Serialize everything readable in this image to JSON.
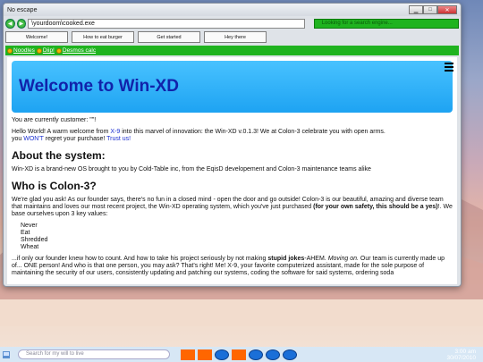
{
  "window": {
    "title": "No escape",
    "address": "\\yourdoom\\cooked.exe",
    "search_placeholder": "Looking for a search engine..."
  },
  "tabs": [
    "Welcome!",
    "How to eat burger",
    "Get started",
    "Hey there"
  ],
  "bookmarks": [
    "Noodles",
    "Diip!",
    "Desmos calc"
  ],
  "page": {
    "banner_title": "Welcome to Win-XD",
    "customer_line": "You are currently customer: \"\"!",
    "intro_a": "Hello World! A warm welcome from ",
    "intro_link": "X-9",
    "intro_b": " into this marvel of innovation: the Win-XD v.0.1.3! We at Colon-3 celebrate you with open arms.",
    "intro_c_pre": "you ",
    "intro_c_wont": "WON'T",
    "intro_c_mid": " regret your purchase! ",
    "intro_c_trust": "Trust us!",
    "h_system": "About the system:",
    "system_text": "Win-XD is a brand-new OS brought to you by Cold-Table inc, from the EqisD developement and Colon-3 maintenance teams alike",
    "h_colon": "Who is Colon-3?",
    "colon_text": "We're glad you ask! As our founder says, there's no fun in a closed mind - open the door and go outside! Colon-3 is our beautiful, amazing and diverse team that maintains and loves our most recent project, the Win-XD operating system, which you've just purchased ",
    "colon_bold": "(for your own safety, this should be a yes)",
    "colon_tail": "!. We base ourselves upon 3 key values:",
    "values": [
      "Never",
      "Eat",
      "Shredded",
      "Wheat"
    ],
    "closing_a": "...if only our founder knew how to count. And how to take his project seriously by not making ",
    "closing_bold": "stupid jokes",
    "closing_b": "-AHEM. ",
    "closing_italic": "Moving on.",
    "closing_c": " Our team is currently made up of... ONE person! And who is that one person, you may ask? That's right! Me! X-9, your favorite computerized assistant, made for the sole purpose of maintaining the security of our users, consistently updating and patching our systems, coding the software for said systems, ordering soda"
  },
  "taskbar": {
    "search_placeholder": "Search for my will to live",
    "time": "3:00 am",
    "date": "30/07/2010"
  },
  "colors": {
    "accent_green": "#1fb31f",
    "banner_blue": "#1ea3f2",
    "link_blue": "#1c2fd0",
    "app_orange": "#ff6600",
    "app_blue": "#1a6fd8"
  }
}
